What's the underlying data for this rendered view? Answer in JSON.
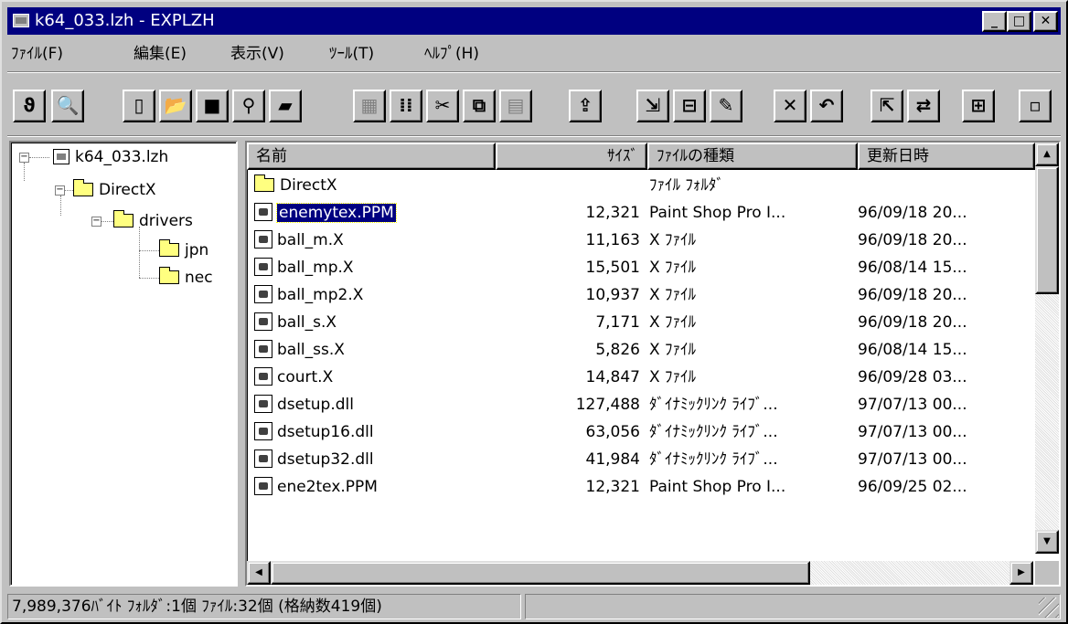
{
  "window": {
    "title": "k64_033.lzh - EXPLZH",
    "controls": {
      "minimize": "_",
      "maximize": "□",
      "close": "✕"
    }
  },
  "menu": [
    "ﾌｧｲﾙ(F)",
    "編集(E)",
    "表示(V)",
    "ﾂｰﾙ(T)",
    "ﾍﾙﾌﾟ(H)"
  ],
  "toolbar": {
    "icons": [
      {
        "name": "connect-icon",
        "glyph": "ϑ",
        "enabled": true
      },
      {
        "name": "find-archive-icon",
        "glyph": "🔍",
        "enabled": true
      },
      {
        "name": "new-icon",
        "glyph": "▯",
        "enabled": true
      },
      {
        "name": "open-icon",
        "glyph": "📂",
        "enabled": true
      },
      {
        "name": "save-icon",
        "glyph": "■",
        "enabled": true
      },
      {
        "name": "find-icon",
        "glyph": "⚲",
        "enabled": true
      },
      {
        "name": "open-folder-icon",
        "glyph": "▰",
        "enabled": true
      },
      {
        "name": "select-icon",
        "glyph": "▦",
        "enabled": false
      },
      {
        "name": "view-icon",
        "glyph": "⁞⁞",
        "enabled": true
      },
      {
        "name": "cut-icon",
        "glyph": "✂",
        "enabled": true
      },
      {
        "name": "copy-icon",
        "glyph": "⧉",
        "enabled": true
      },
      {
        "name": "paste-icon",
        "glyph": "▤",
        "enabled": false
      },
      {
        "name": "extract-icon",
        "glyph": "⇪",
        "enabled": true
      },
      {
        "name": "compress-icon",
        "glyph": "⇲",
        "enabled": true
      },
      {
        "name": "properties-icon",
        "glyph": "⊟",
        "enabled": true
      },
      {
        "name": "edit-icon",
        "glyph": "✎",
        "enabled": true
      },
      {
        "name": "delete-icon",
        "glyph": "✕",
        "enabled": true
      },
      {
        "name": "rename-icon",
        "glyph": "↶",
        "enabled": true
      },
      {
        "name": "move-icon",
        "glyph": "⇱",
        "enabled": true
      },
      {
        "name": "swap-icon",
        "glyph": "⇄",
        "enabled": true
      },
      {
        "name": "options-icon",
        "glyph": "⊞",
        "enabled": true
      },
      {
        "name": "view-mode-icon",
        "glyph": "▫",
        "enabled": true
      }
    ]
  },
  "tree": {
    "root": "k64_033.lzh",
    "nodes": [
      {
        "label": "DirectX"
      },
      {
        "label": "drivers"
      },
      {
        "label": "jpn"
      },
      {
        "label": "nec"
      }
    ]
  },
  "list": {
    "columns": {
      "name": "名前",
      "size": "ｻｲｽﾞ",
      "type": "ﾌｧｲﾙの種類",
      "date": "更新日時"
    },
    "rows": [
      {
        "name": "DirectX",
        "size": "",
        "type": "ﾌｧｲﾙ ﾌｫﾙﾀﾞ",
        "date": "",
        "icon": "folder"
      },
      {
        "name": "enemytex.PPM",
        "size": "12,321",
        "type": "Paint Shop Pro I...",
        "date": "96/09/18 20...",
        "icon": "file",
        "selected": true
      },
      {
        "name": "ball_m.X",
        "size": "11,163",
        "type": "X ﾌｧｲﾙ",
        "date": "96/09/18 20...",
        "icon": "file"
      },
      {
        "name": "ball_mp.X",
        "size": "15,501",
        "type": "X ﾌｧｲﾙ",
        "date": "96/08/14 15...",
        "icon": "file"
      },
      {
        "name": "ball_mp2.X",
        "size": "10,937",
        "type": "X ﾌｧｲﾙ",
        "date": "96/09/18 20...",
        "icon": "file"
      },
      {
        "name": "ball_s.X",
        "size": "7,171",
        "type": "X ﾌｧｲﾙ",
        "date": "96/09/18 20...",
        "icon": "file"
      },
      {
        "name": "ball_ss.X",
        "size": "5,826",
        "type": "X ﾌｧｲﾙ",
        "date": "96/08/14 15...",
        "icon": "file"
      },
      {
        "name": "court.X",
        "size": "14,847",
        "type": "X ﾌｧｲﾙ",
        "date": "96/09/28 03...",
        "icon": "file"
      },
      {
        "name": "dsetup.dll",
        "size": "127,488",
        "type": "ﾀﾞｲﾅﾐｯｸﾘﾝｸ ﾗｲﾌﾞ...",
        "date": "97/07/13 00...",
        "icon": "file"
      },
      {
        "name": "dsetup16.dll",
        "size": "63,056",
        "type": "ﾀﾞｲﾅﾐｯｸﾘﾝｸ ﾗｲﾌﾞ...",
        "date": "97/07/13 00...",
        "icon": "file"
      },
      {
        "name": "dsetup32.dll",
        "size": "41,984",
        "type": "ﾀﾞｲﾅﾐｯｸﾘﾝｸ ﾗｲﾌﾞ...",
        "date": "97/07/13 00...",
        "icon": "file"
      },
      {
        "name": "ene2tex.PPM",
        "size": "12,321",
        "type": "Paint Shop Pro I...",
        "date": "96/09/25 02...",
        "icon": "file"
      }
    ]
  },
  "status": {
    "text": "7,989,376ﾊﾞｲﾄ ﾌｫﾙﾀﾞ:1個 ﾌｧｲﾙ:32個 (格納数419個)",
    "panel2": ""
  },
  "colors": {
    "titlebar": "#000080",
    "face": "#c0c0c0",
    "folder": "#ffff80",
    "selection": "#000080"
  }
}
